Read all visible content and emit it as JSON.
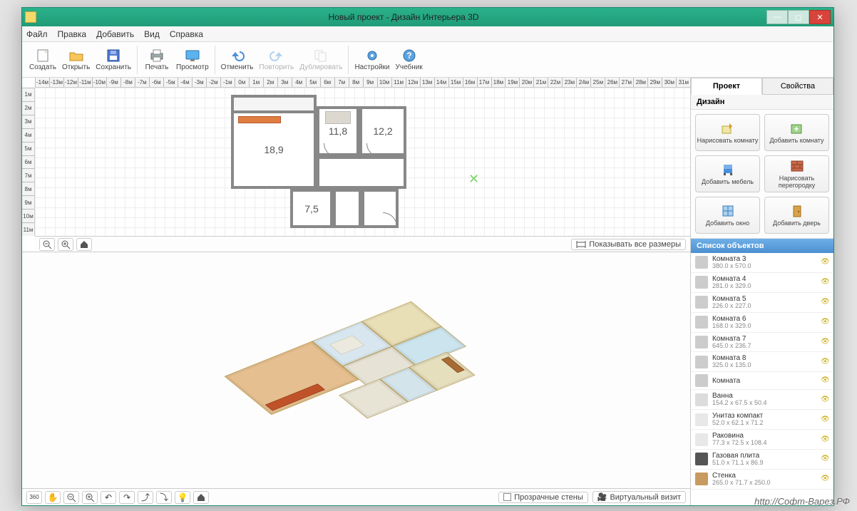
{
  "window": {
    "title": "Новый проект - Дизайн Интерьера 3D"
  },
  "menu": {
    "file": "Файл",
    "edit": "Правка",
    "add": "Добавить",
    "view": "Вид",
    "help": "Справка"
  },
  "toolbar": {
    "create": "Создать",
    "open": "Открыть",
    "save": "Сохранить",
    "print": "Печать",
    "preview": "Просмотр",
    "undo": "Отменить",
    "redo": "Повторить",
    "duplicate": "Дублировать",
    "settings": "Настройки",
    "tutorial": "Учебник"
  },
  "ruler_h": [
    "-14м",
    "-13м",
    "-12м",
    "-11м",
    "-10м",
    "-9м",
    "-8м",
    "-7м",
    "-6м",
    "-5м",
    "-4м",
    "-3м",
    "-2м",
    "-1м",
    "0м",
    "1м",
    "2м",
    "3м",
    "4м",
    "5м",
    "6м",
    "7м",
    "8м",
    "9м",
    "10м",
    "11м",
    "12м",
    "13м",
    "14м",
    "15м",
    "16м",
    "17м",
    "18м",
    "19м",
    "20м",
    "21м",
    "22м",
    "23м",
    "24м",
    "25м",
    "26м",
    "27м",
    "28м",
    "29м",
    "30м",
    "31м"
  ],
  "ruler_v": [
    "1м",
    "2м",
    "3м",
    "4м",
    "5м",
    "6м",
    "7м",
    "8м",
    "9м",
    "10м",
    "11м"
  ],
  "plan": {
    "r1": "18,9",
    "r2": "11,8",
    "r3": "12,2",
    "r4": "7,5"
  },
  "bar2d": {
    "show_sizes": "Показывать все размеры"
  },
  "bar3d": {
    "transparent": "Прозрачные стены",
    "virtual": "Виртуальный визит"
  },
  "tabs": {
    "project": "Проект",
    "properties": "Свойства"
  },
  "sections": {
    "design": "Дизайн",
    "objects": "Список объектов"
  },
  "design_btns": {
    "draw_room": "Нарисовать комнату",
    "add_room": "Добавить комнату",
    "add_furniture": "Добавить мебель",
    "draw_partition": "Нарисовать перегородку",
    "add_window": "Добавить окно",
    "add_door": "Добавить дверь"
  },
  "objects": [
    {
      "name": "Комната 3",
      "dim": "380.0 x 570.0",
      "icon": "room"
    },
    {
      "name": "Комната 4",
      "dim": "281.0 x 329.0",
      "icon": "room"
    },
    {
      "name": "Комната 5",
      "dim": "226.0 x 227.0",
      "icon": "room"
    },
    {
      "name": "Комната 6",
      "dim": "168.0 x 329.0",
      "icon": "room"
    },
    {
      "name": "Комната 7",
      "dim": "645.0 x 236.7",
      "icon": "room"
    },
    {
      "name": "Комната 8",
      "dim": "325.0 x 135.0",
      "icon": "room"
    },
    {
      "name": "Комната",
      "dim": "",
      "icon": "room"
    },
    {
      "name": "Ванна",
      "dim": "154.2 x 67.5 x 50.4",
      "icon": "bath"
    },
    {
      "name": "Унитаз компакт",
      "dim": "52.0 x 62.1 x 71.2",
      "icon": "toilet"
    },
    {
      "name": "Раковина",
      "dim": "77.3 x 72.5 x 108.4",
      "icon": "sink"
    },
    {
      "name": "Газовая плита",
      "dim": "51.0 x 71.1 x 86.9",
      "icon": "stove"
    },
    {
      "name": "Стенка",
      "dim": "265.0 x 71.7 x 250.0",
      "icon": "cabinet"
    }
  ],
  "watermark": "http://Софт-Варез.РФ"
}
